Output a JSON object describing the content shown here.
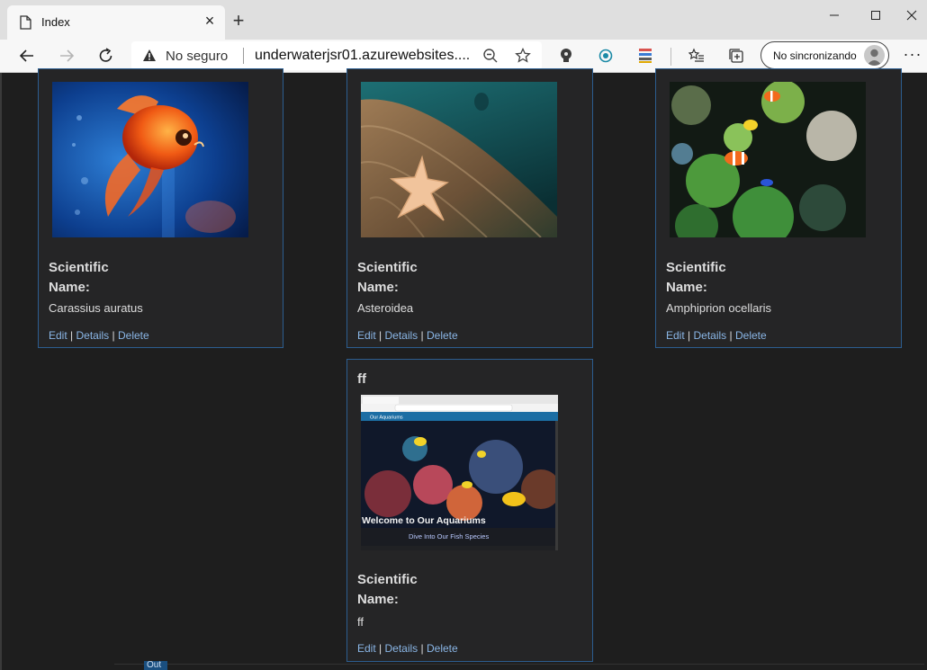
{
  "browser": {
    "tab_title": "Index",
    "tab_close": "×",
    "new_tab": "+",
    "security_label": "No seguro",
    "url": "underwaterjsr01.azurewebsites....",
    "sync_label": "No sincronizando",
    "more_label": "···"
  },
  "cards": [
    {
      "heading": "Scientific Name:",
      "heading_line1": "Scientific",
      "heading_line2": "Name:",
      "value": "Carassius auratus",
      "image": "goldfish-photo"
    },
    {
      "heading": "Scientific Name:",
      "heading_line1": "Scientific",
      "heading_line2": "Name:",
      "value": "Asteroidea",
      "image": "starfish-photo"
    },
    {
      "heading": "Scientific Name:",
      "heading_line1": "Scientific",
      "heading_line2": "Name:",
      "value": "Amphiprion ocellaris",
      "image": "clownfish-reef-photo"
    },
    {
      "title": "ff",
      "heading": "Scientific Name:",
      "heading_line1": "Scientific",
      "heading_line2": "Name:",
      "value": "ff",
      "image": "aquarium-site-screenshot",
      "screenshot": {
        "site_title": "Our Aquariums",
        "headline": "Welcome to Our Aquariums",
        "subline": "Dive Into Our Fish Species"
      }
    }
  ],
  "links": {
    "edit": "Edit",
    "details": "Details",
    "delete": "Delete",
    "separator": "|"
  },
  "footer_fragment": "Out"
}
